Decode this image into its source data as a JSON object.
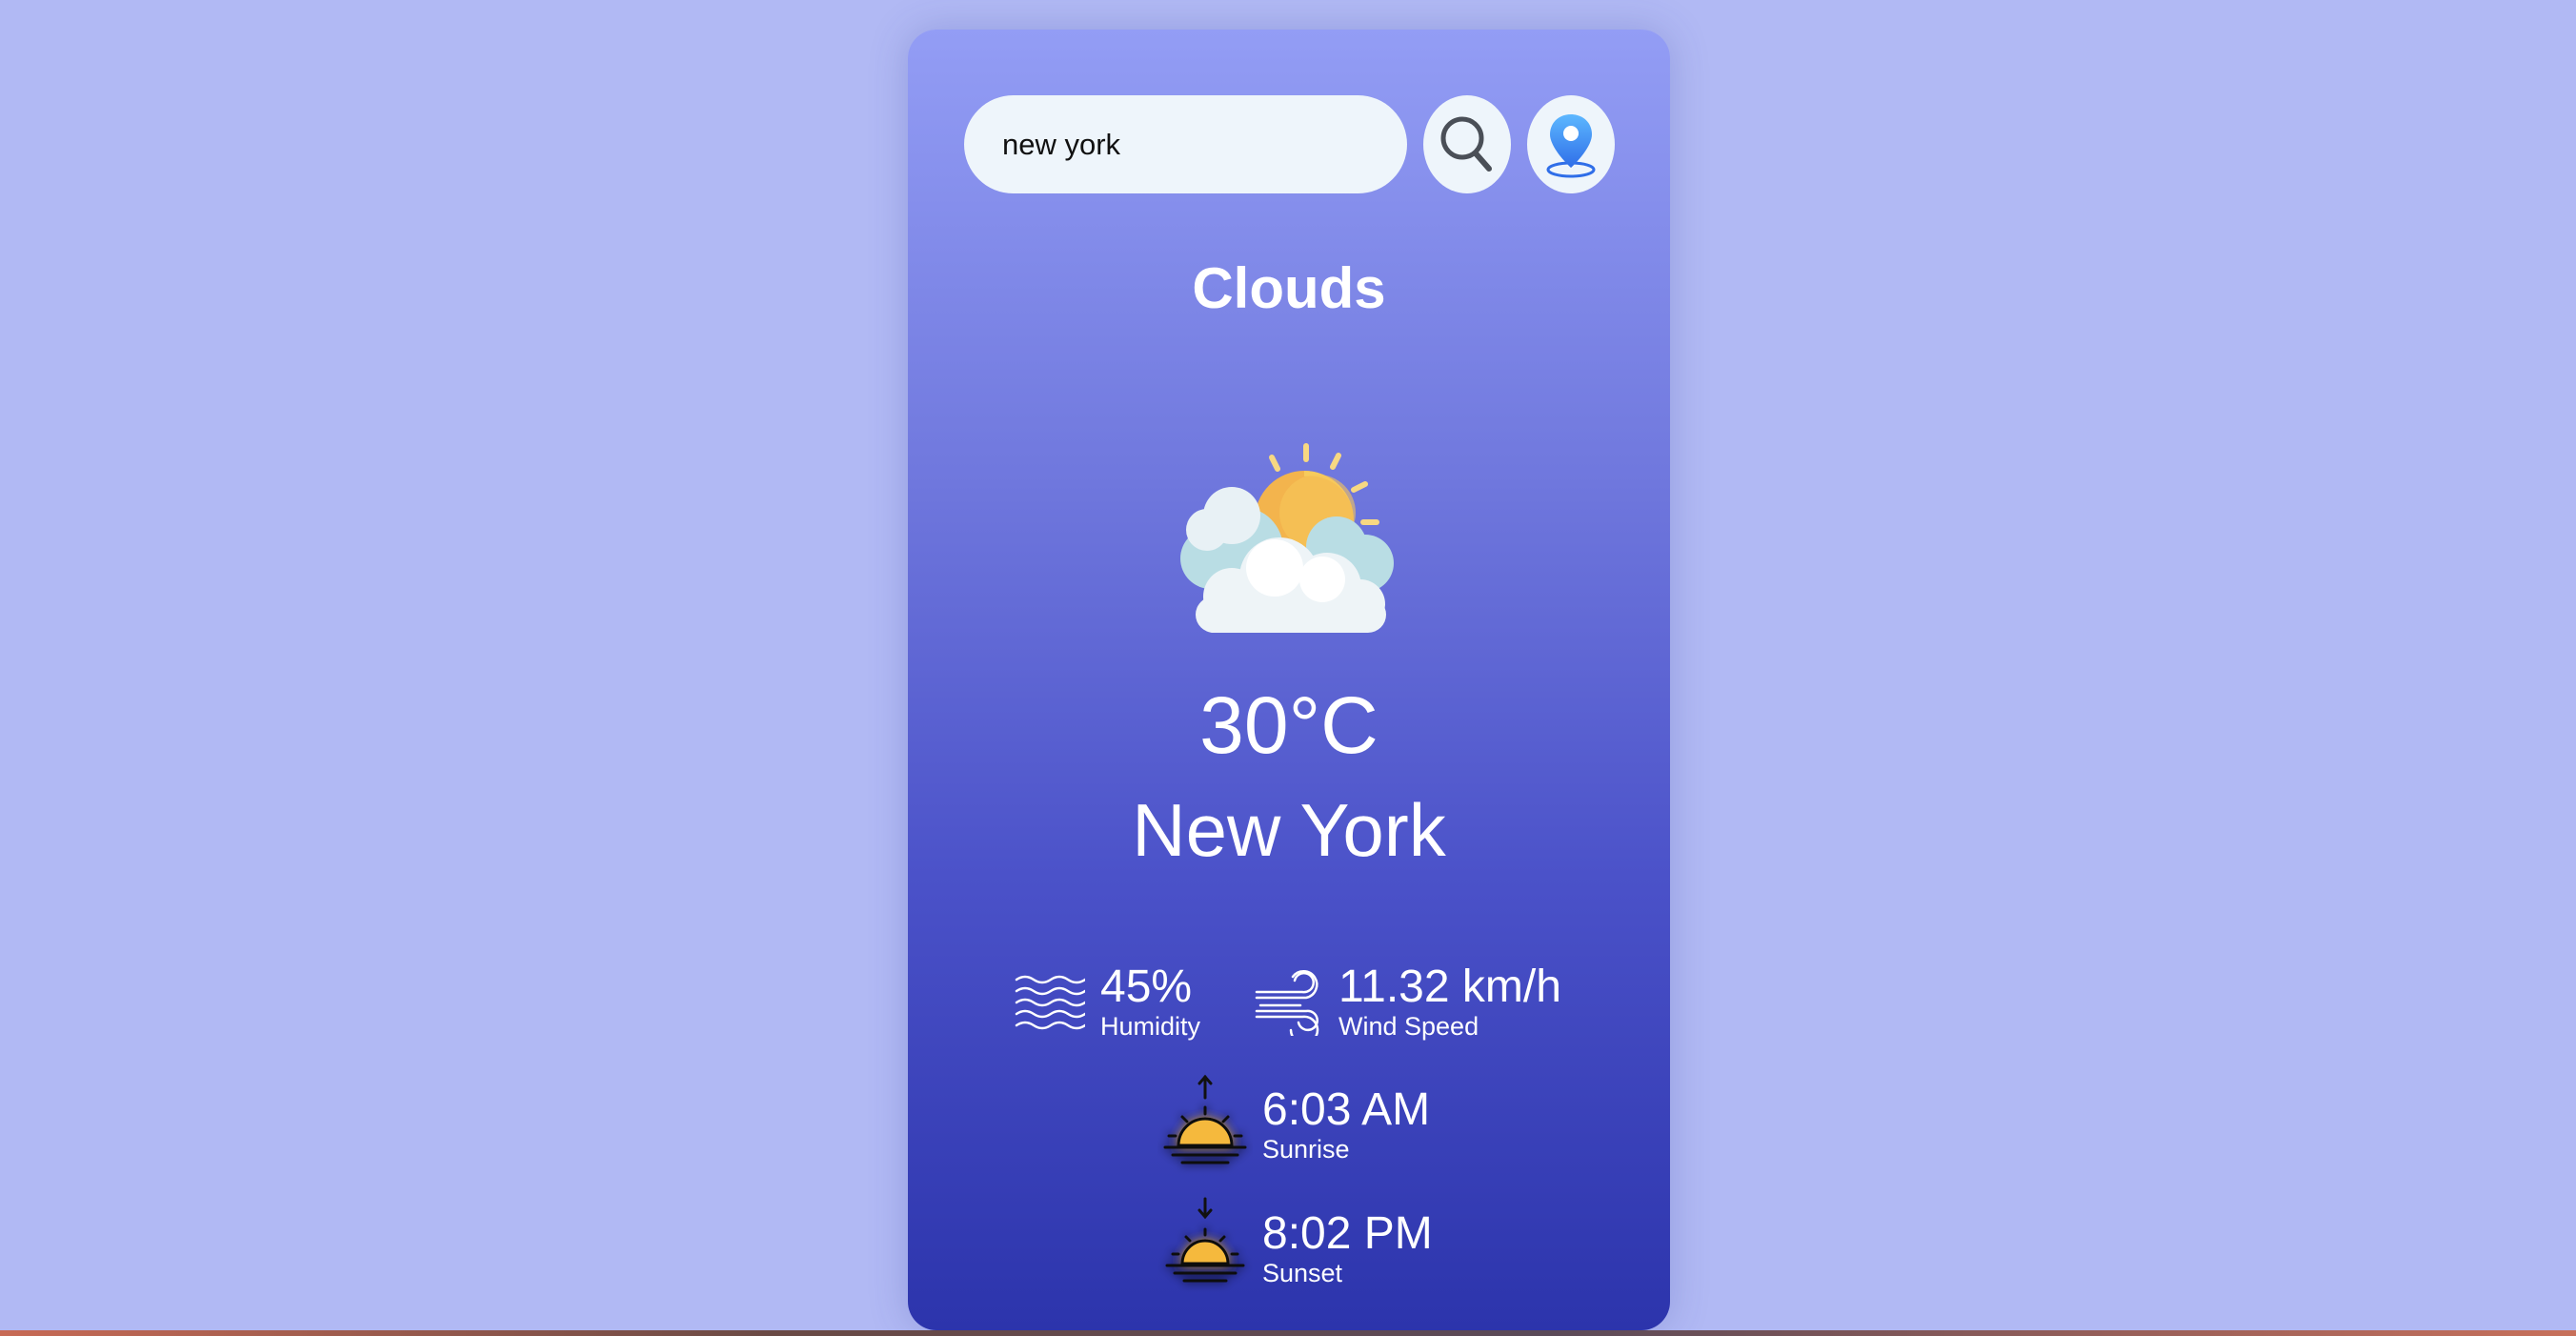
{
  "search": {
    "value": "new york",
    "icon": "search-icon"
  },
  "location": {
    "icon": "location-pin-icon"
  },
  "weather": {
    "condition": "Clouds",
    "icon": "partly-cloudy-icon",
    "temperature": "30°C",
    "city": "New York"
  },
  "stats": {
    "humidity": {
      "value": "45%",
      "label": "Humidity",
      "icon": "humidity-waves-icon"
    },
    "wind": {
      "value": "11.32 km/h",
      "label": "Wind Speed",
      "icon": "wind-icon"
    },
    "sunrise": {
      "value": "6:03 AM",
      "label": "Sunrise",
      "icon": "sunrise-icon"
    },
    "sunset": {
      "value": "8:02 PM",
      "label": "Sunset",
      "icon": "sunset-icon"
    }
  },
  "colors": {
    "page_background": "#b1b9f4",
    "card_top": "#939df5",
    "card_bottom": "#2c34ac",
    "sun": "#f5b93c"
  }
}
